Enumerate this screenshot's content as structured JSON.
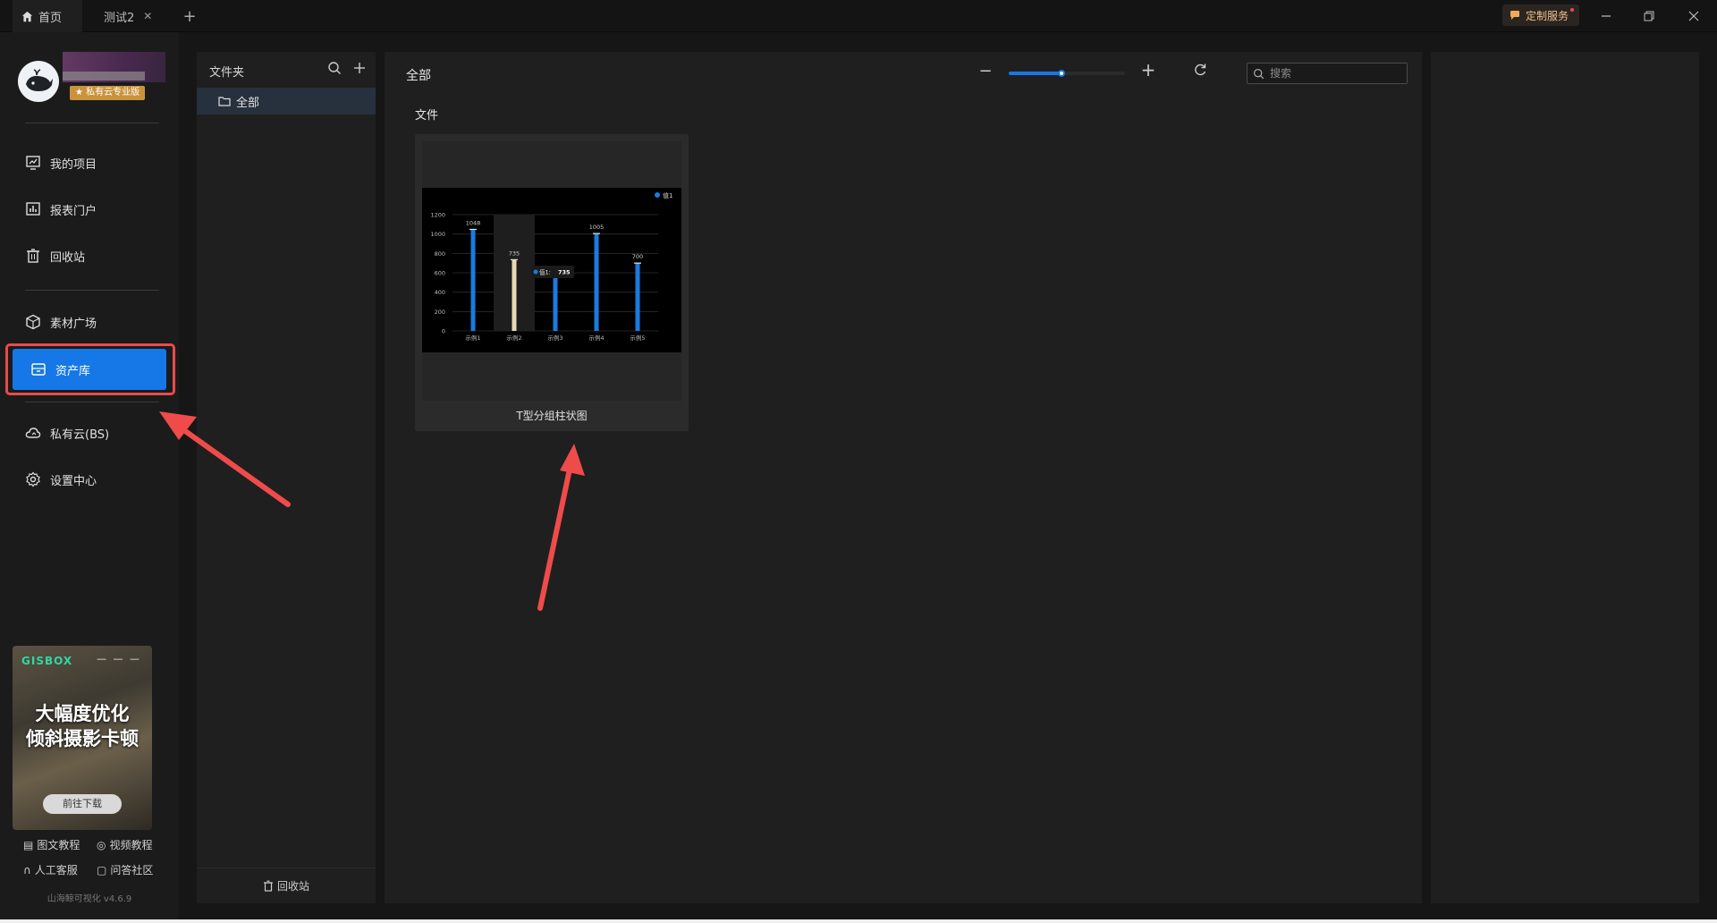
{
  "titlebar": {
    "home_tab": "首页",
    "test_tab": "测试2",
    "custom_service": "定制服务"
  },
  "user": {
    "badge": "私有云专业版"
  },
  "nav": {
    "my_projects": "我的项目",
    "report_portal": "报表门户",
    "recycle_bin": "回收站",
    "material_square": "素材广场",
    "asset_library": "资产库",
    "private_cloud": "私有云(BS)",
    "settings": "设置中心"
  },
  "promo": {
    "logo": "GISBOX",
    "line1": "大幅度优化",
    "line2": "倾斜摄影卡顿",
    "button": "前往下载"
  },
  "help": {
    "text_tutorial": "图文教程",
    "video_tutorial": "视频教程",
    "support": "人工客服",
    "community": "问答社区"
  },
  "version": "山海鲸可视化 v4.6.9",
  "folder_panel": {
    "title": "文件夹",
    "all": "全部",
    "recycle": "回收站"
  },
  "main": {
    "title": "全部",
    "section": "文件",
    "search_placeholder": "搜索",
    "zoom_level": 0.45
  },
  "card": {
    "name": "T型分组柱状图"
  },
  "chart_data": {
    "type": "bar",
    "categories": [
      "示例1",
      "示例2",
      "示例3",
      "示例4",
      "示例5"
    ],
    "series": [
      {
        "name": "值1",
        "values": [
          1048,
          735,
          580,
          1005,
          700
        ]
      }
    ],
    "data_labels": [
      "1048",
      "735",
      "580",
      "1005",
      "700"
    ],
    "yticks": [
      "0",
      "200",
      "400",
      "600",
      "800",
      "1000",
      "1200"
    ],
    "ylim": [
      0,
      1200
    ],
    "highlight_index": 1,
    "tooltip": {
      "series": "值1",
      "value": "735"
    },
    "colors": {
      "bar": "#1a7be0",
      "highlight": "#e8d9b5"
    },
    "legend": "top-right"
  },
  "colors": {
    "accent": "#1677e6",
    "annotation": "#e94b4b"
  }
}
